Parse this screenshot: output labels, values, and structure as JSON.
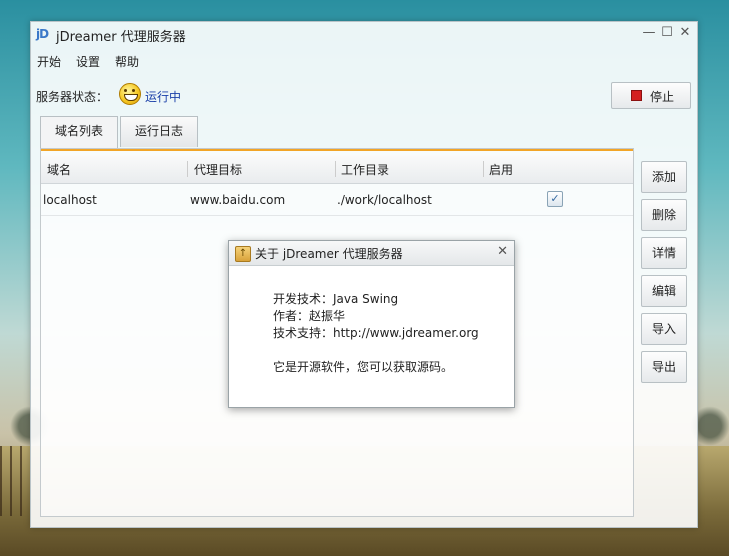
{
  "window": {
    "title": "jDreamer 代理服务器",
    "app_icon": "jD",
    "controls": {
      "minimize": "—",
      "maximize": "☐",
      "close": "✕"
    }
  },
  "menu": [
    "开始",
    "设置",
    "帮助"
  ],
  "status": {
    "label": "服务器状态：",
    "value": "运行中",
    "value_color": "#1a3fa8"
  },
  "stop_button": {
    "label": "停止",
    "icon_color": "#d41f1f"
  },
  "tabs": [
    {
      "label": "域名列表",
      "active": true
    },
    {
      "label": "运行日志",
      "active": false
    }
  ],
  "table": {
    "columns": [
      "域名",
      "代理目标",
      "工作目录",
      "启用"
    ],
    "rows": [
      {
        "domain": "localhost",
        "target": "www.baidu.com",
        "workdir": "./work/localhost",
        "enabled": true
      }
    ],
    "check_mark": "✓"
  },
  "side_buttons": [
    "添加",
    "删除",
    "详情",
    "编辑",
    "导入",
    "导出"
  ],
  "about_dialog": {
    "title": "关于 jDreamer 代理服务器",
    "close": "✕",
    "lines": [
      "开发技术：Java Swing",
      "作者：赵振华",
      "技术支持：http://www.jdreamer.org",
      "它是开源软件，您可以获取源码。"
    ]
  },
  "accent_color": "#f2a527"
}
